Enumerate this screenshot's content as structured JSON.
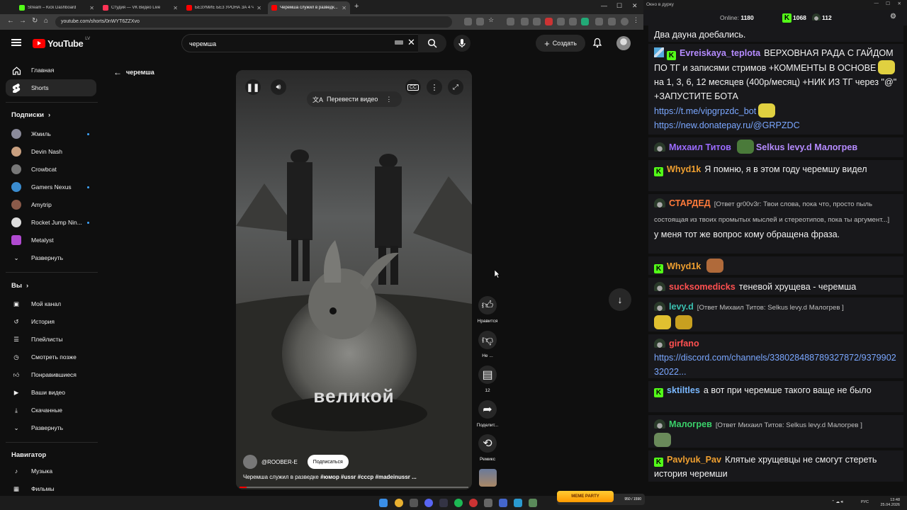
{
  "browser": {
    "tabs": [
      {
        "title": "Stream – Kick Dashboard",
        "color": "#53fc18"
      },
      {
        "title": "Студия — VK Видео Live",
        "color": "#ff3355"
      },
      {
        "title": "БЕЗУМИЕ БЕЗ УРОНА ЗА 4 ЧА...",
        "color": "#ff0000"
      },
      {
        "title": "Черемша служил в разведк...",
        "color": "#ff0000"
      }
    ],
    "url": "youtube.com/shorts/0nWYT6ZZXvo"
  },
  "youtube": {
    "logo_text": "YouTube",
    "country": "LV",
    "search_value": "черемша",
    "create_label": "Создать",
    "sidebar": {
      "home": "Главная",
      "shorts": "Shorts",
      "subscriptions_header": "Подписки",
      "subscriptions": [
        {
          "name": "Жмиль",
          "new": true,
          "color": "#8a8a9a"
        },
        {
          "name": "Devin Nash",
          "new": false,
          "color": "#c9a080"
        },
        {
          "name": "Crowbcat",
          "new": false,
          "color": "#777777"
        },
        {
          "name": "Gamers Nexus",
          "new": true,
          "color": "#3a8ccf"
        },
        {
          "name": "Amytrip",
          "new": false,
          "color": "#8a5a4a"
        },
        {
          "name": "Rocket Jump Nin...",
          "new": true,
          "color": "#dddddd"
        },
        {
          "name": "Metalyst",
          "new": false,
          "color": "#b04ad0"
        }
      ],
      "expand1": "Развернуть",
      "you_header": "Вы",
      "you_items": [
        "Мой канал",
        "История",
        "Плейлисты",
        "Смотреть позже",
        "Понравившиеся",
        "Ваши видео",
        "Скачанные"
      ],
      "expand2": "Развернуть",
      "nav_header": "Навигатор",
      "nav_items": [
        "Музыка",
        "Фильмы"
      ]
    },
    "back_label": "черемша",
    "short": {
      "translate_label": "Перевести видео",
      "caption_overlay": "великой",
      "channel": "@ROOBER-E",
      "subscribe_label": "Подписаться",
      "description": "Черемша служил в разведке",
      "hashtags": "#юмор #ussr #сссp #madeinussr ...",
      "progress": 0.03,
      "actions": {
        "like": "Нравится",
        "dislike": "Не ...",
        "comments": "12",
        "share": "Поделит...",
        "remix": "Ремикс"
      }
    }
  },
  "chat": {
    "window_title": "Окно в дурку",
    "online_label": "Online:",
    "online_value": "1180",
    "kick_count": "1068",
    "helmet_count": "112",
    "top_line": "Два дауна доебались.",
    "messages": [
      {
        "name": "Evreiskaya_teplota",
        "name_color": "#b58bff",
        "text": "ВЕРХОВНАЯ РАДА С ГАЙДОМ ПО ТГ и записями стримов +КОММЕНТЫ В ОСНОВЕ",
        "text2": "на 1, 3, 6, 12 месяцев (400р/месяц) +НИК ИЗ ТГ через \"@\" +ЗАПУСТИТЕ БОТА",
        "link1": "https://t.me/vipgrpzdc_bot",
        "link2": "https://new.donatepay.ru/@GRPZDC"
      },
      {
        "name": "Михаил Титов",
        "name_color": "#9b6bff",
        "text": "Selkus levy.d Малогрев"
      },
      {
        "name": "Whyd1k",
        "name_color": "#f0a030",
        "text": "Я помню, я в этом году черемшу видел"
      },
      {
        "name": "СТАРДЕД",
        "name_color": "#ff7a3a",
        "reply": "[Ответ gr00v3r: Твои слова, пока что, просто пыль состоящая из твоих промытых мыслей и стереотипов, пока ты аргумент...]",
        "text": "у меня тот же вопрос кому обращена фраза."
      },
      {
        "name": "Whyd1k",
        "name_color": "#f0a030",
        "text": ""
      },
      {
        "name": "sucksomedicks",
        "name_color": "#ff5050",
        "text": "теневой хрущева - черемша"
      },
      {
        "name": "levy.d",
        "name_color": "#3ac0b0",
        "reply": "[Ответ Михаил Титов: Selkus levy.d Малогрев ]",
        "text": ""
      },
      {
        "name": "girfano",
        "name_color": "#ff5050",
        "link": "https://discord.com/channels/338028488789327872/937990232022..."
      },
      {
        "name": "sktiltles",
        "name_color": "#7ab8ff",
        "text": "а вот при черемше такого ваще не было"
      },
      {
        "name": "Малогрев",
        "name_color": "#3ad06a",
        "reply": "[Ответ Михаил Титов: Selkus levy.d Малогрев ]",
        "text": ""
      },
      {
        "name": "Pavlyuk_Pav",
        "name_color": "#f0a030",
        "text": "Клятые хрущевцы не смогут стереть история черемши"
      }
    ]
  },
  "taskbar": {
    "meme_badge": "MEME PARTY",
    "wallet": "950 / 1590",
    "lang": "РУС",
    "time": "13:48",
    "date": "25.04.2026"
  }
}
